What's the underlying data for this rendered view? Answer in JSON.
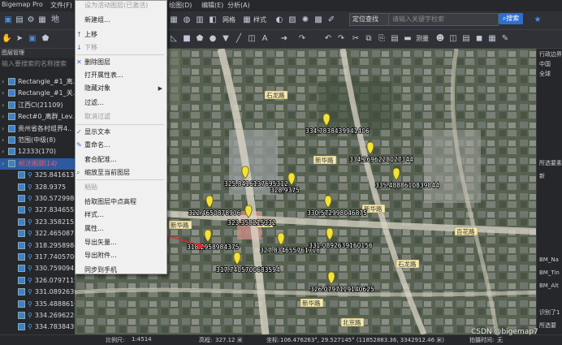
{
  "app": {
    "title": "Bigemap Pro"
  },
  "menubar": {
    "file": "文件(F)",
    "trace": "地",
    "undo_hint": "设为活动图层(已激活)",
    "draw": "绘图(D)",
    "edit": "编辑(E)",
    "analysis": "分析(A)",
    "item_l": "上",
    "item_h": "帮"
  },
  "toolbar": {
    "grid_label": "网格",
    "style_label": "样式",
    "search_mode": "定位查找",
    "search_placeholder": "请输入关键字检索",
    "search_button": "搜索",
    "measure_label": "测量"
  },
  "left_panel": {
    "header": "图层管理",
    "search_placeholder": "输入要搜索的名称搜索",
    "rows": [
      {
        "label": "Rectangle_#1_离..",
        "type": "layer"
      },
      {
        "label": "Rectangle_#1_关..",
        "type": "layer"
      },
      {
        "label": "江西Cl(21109)",
        "type": "layer"
      },
      {
        "label": "Rect#0_离群_Lev..",
        "type": "layer"
      },
      {
        "label": "贵州省各村组界4..",
        "type": "layer"
      },
      {
        "label": "范围(中级(8)",
        "type": "layer"
      },
      {
        "label": "12333(170)",
        "type": "layer"
      },
      {
        "label": "标注图层(14)",
        "type": "layer",
        "selected": true
      },
      {
        "label": "325.841613798",
        "type": "point"
      },
      {
        "label": "328.9375",
        "type": "point"
      },
      {
        "label": "330.572998046",
        "type": "point"
      },
      {
        "label": "327.834655761",
        "type": "point"
      },
      {
        "label": "323.358215332",
        "type": "point"
      },
      {
        "label": "322.465087890",
        "type": "point"
      },
      {
        "label": "318.295898437",
        "type": "point"
      },
      {
        "label": "317.740570068",
        "type": "point"
      },
      {
        "label": "330.759094238",
        "type": "point"
      },
      {
        "label": "326.0797119140625",
        "type": "point"
      },
      {
        "label": "331.0892639160156",
        "type": "point"
      },
      {
        "label": "335.4888610839844",
        "type": "point"
      },
      {
        "label": "334.2696228027344",
        "type": "point"
      },
      {
        "label": "334.7838439941406",
        "type": "point"
      }
    ]
  },
  "context_menu": {
    "header": "设为活动图层(已激活)",
    "items": [
      {
        "label": "新建组...",
        "disabled": false
      },
      {
        "label": "上移",
        "disabled": false,
        "glyph": "↑"
      },
      {
        "label": "下移",
        "disabled": true,
        "glyph": "↓"
      },
      {
        "label": "删除图层",
        "disabled": false,
        "glyph": "✕"
      },
      {
        "label": "打开属性表...",
        "disabled": false
      },
      {
        "label": "隐藏对象",
        "disabled": false,
        "submenu": true
      },
      {
        "label": "过滤...",
        "disabled": false
      },
      {
        "label": "取消过滤",
        "disabled": true
      },
      {
        "label": "显示文本",
        "disabled": false,
        "check": true
      },
      {
        "label": "重命名...",
        "disabled": false,
        "glyph": "✎"
      },
      {
        "label": "套合配准...",
        "disabled": false
      },
      {
        "label": "缩放至当前图层",
        "disabled": false,
        "glyph": "⌕"
      },
      {
        "label": "粘贴",
        "disabled": true
      },
      {
        "label": "拾取图层中点高程",
        "disabled": false
      },
      {
        "label": "样式...",
        "disabled": false
      },
      {
        "label": "属性...",
        "disabled": false
      },
      {
        "label": "导出矢量...",
        "disabled": false
      },
      {
        "label": "导出附件...",
        "disabled": false
      },
      {
        "label": "同步到手机",
        "disabled": false
      }
    ]
  },
  "map": {
    "markers": [
      {
        "label": "334.7838439941406"
      },
      {
        "label": "334.2696228027344"
      },
      {
        "label": "335.4888610839844"
      },
      {
        "label": "325.8416137695312"
      },
      {
        "label": "328.9375"
      },
      {
        "label": "322.4650878906"
      },
      {
        "label": "323.358215332"
      },
      {
        "label": "330.572998046875"
      },
      {
        "label": "318.2958984375"
      },
      {
        "label": "327.834655761718"
      },
      {
        "label": "331.0892639160156"
      },
      {
        "label": "317.7405700683594"
      },
      {
        "label": "326.0797119140625"
      }
    ],
    "road_labels": [
      "石龙路",
      "新华路",
      "新华路",
      "华路",
      "新华路",
      "石龙路",
      "百花路",
      "新华路",
      "北京路"
    ]
  },
  "right_panel": {
    "title": "行政边界",
    "items": [
      "中国",
      "全球"
    ],
    "sel_title": "所选要素",
    "sel_sub": "新",
    "rows": [
      "BM_Na",
      "BM_Tin",
      "BM_Alt"
    ],
    "foot1": "识别了1",
    "foot2": "所选要"
  },
  "statusbar": {
    "scale_label": "比例尺:",
    "scale": "1:4514",
    "elev_label": "高程:",
    "elev": "327.12 米",
    "coord_label": "坐标:",
    "coord": "106.476263°, 29.527145° (11852883.36, 3342912.46 米)",
    "tiles_label": "拍摄时间:",
    "tiles": "无"
  },
  "watermark": "CSDN @bigemap7"
}
